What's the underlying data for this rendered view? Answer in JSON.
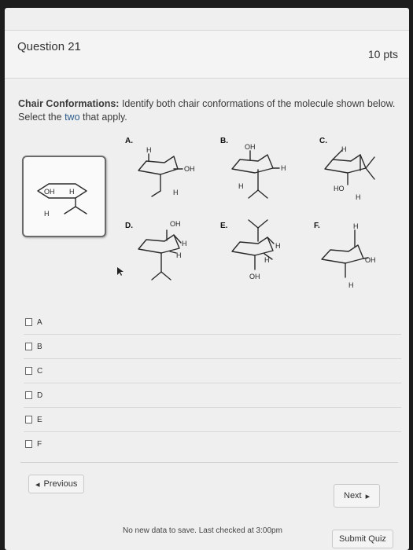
{
  "question": {
    "title": "Question 21",
    "points": "10 pts",
    "prompt_bold": "Chair Conformations:",
    "prompt_text_1": " Identify both chair conformations of the molecule shown below. Select the ",
    "prompt_accent": "two",
    "prompt_text_2": " that apply."
  },
  "structures": {
    "reference": {
      "oh": "OH",
      "h1": "H",
      "h2": "H"
    },
    "A": {
      "letter": "A.",
      "h_top": "H",
      "oh": "OH",
      "h_bottom": "H"
    },
    "B": {
      "letter": "B.",
      "oh": "OH",
      "h_right": "H",
      "h_left": "H"
    },
    "C": {
      "letter": "C.",
      "h_top": "H",
      "ho": "HO",
      "h_bottom": "H"
    },
    "D": {
      "letter": "D.",
      "oh": "OH",
      "h_right": "H",
      "h_mid": "H"
    },
    "E": {
      "letter": "E.",
      "h_right": "H",
      "h_mid": "H",
      "oh": "OH"
    },
    "F": {
      "letter": "F.",
      "h_top": "H",
      "oh": "OH",
      "h_bottom": "H"
    }
  },
  "choices": [
    "A",
    "B",
    "C",
    "D",
    "E",
    "F"
  ],
  "nav": {
    "previous": "Previous",
    "next": "Next",
    "prev_arrow": "◂",
    "next_arrow": "▸",
    "status": "No new data to save. Last checked at 3:00pm",
    "submit": "Submit Quiz"
  }
}
